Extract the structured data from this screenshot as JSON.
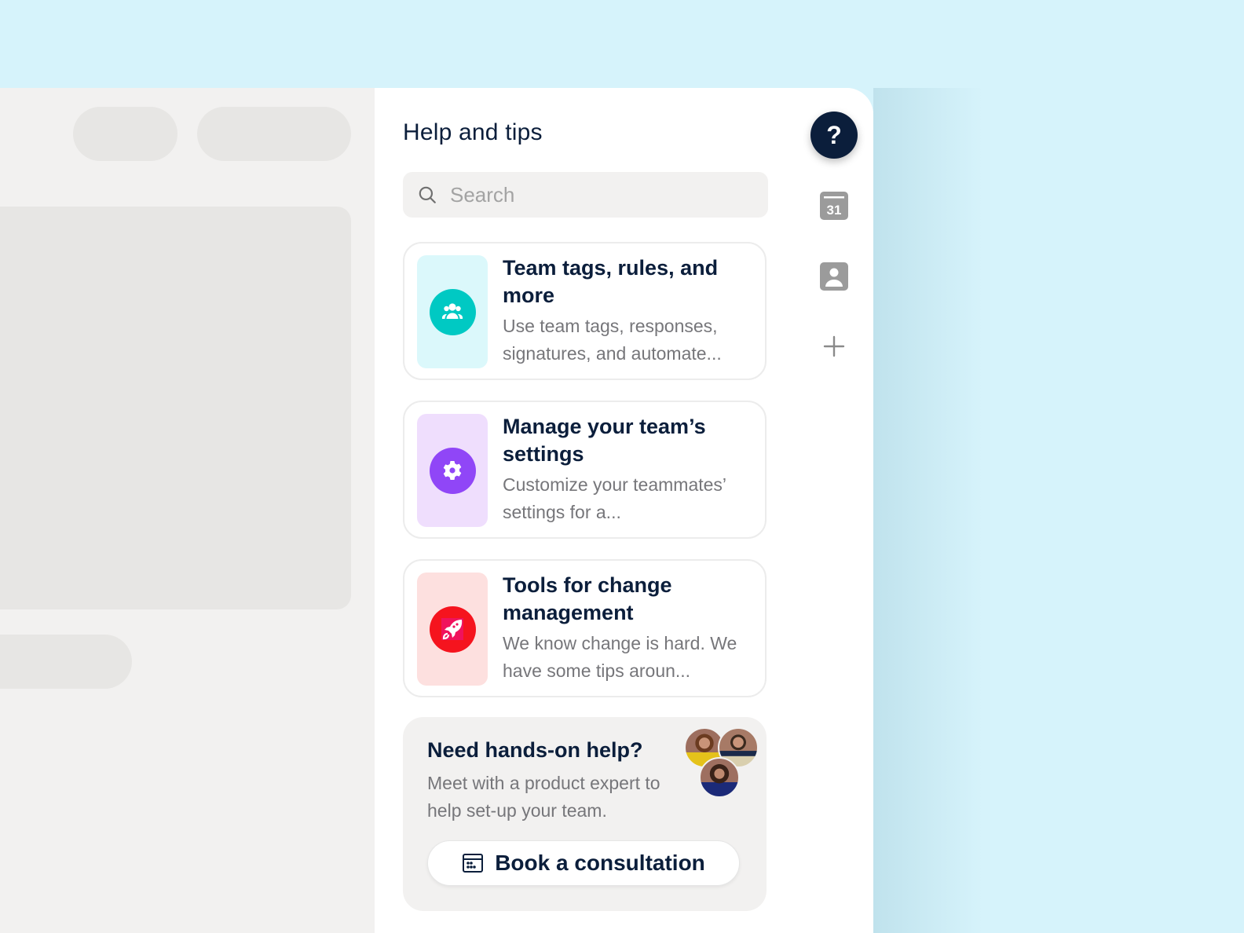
{
  "help_panel": {
    "title": "Help and tips",
    "search": {
      "placeholder": "Search",
      "value": ""
    },
    "cards": [
      {
        "title": "Team tags, rules, and more",
        "description": "Use team tags, responses, signatures, and automate...",
        "icon": "team-icon",
        "thumb_color": "#dbf8fb",
        "icon_color": "#00c9c3"
      },
      {
        "title": "Manage your team’s settings",
        "description": "Customize your teammates’ settings for a...",
        "icon": "gear-icon",
        "thumb_color": "#efdefd",
        "icon_color": "#9046f7"
      },
      {
        "title": "Tools for change management",
        "description": "We know change is hard. We have some tips aroun...",
        "icon": "rocket-icon",
        "thumb_color": "#fde0df",
        "icon_color": "#f5141e"
      }
    ],
    "consultation": {
      "title": "Need hands-on help?",
      "description": "Meet with a product expert to help set-up your team.",
      "button_label": "Book a consultation"
    }
  },
  "rail": {
    "items": [
      {
        "name": "help",
        "label": "?",
        "icon": "help-icon"
      },
      {
        "name": "calendar",
        "label": "31",
        "icon": "calendar-icon"
      },
      {
        "name": "contacts",
        "icon": "contact-icon"
      },
      {
        "name": "add",
        "icon": "plus-icon"
      }
    ]
  },
  "colors": {
    "background": "#d6f3fb",
    "navy": "#0b1e3b",
    "muted_text": "#76767a",
    "skeleton": "#e7e6e4",
    "rail_icon": "#9b9b9b"
  }
}
